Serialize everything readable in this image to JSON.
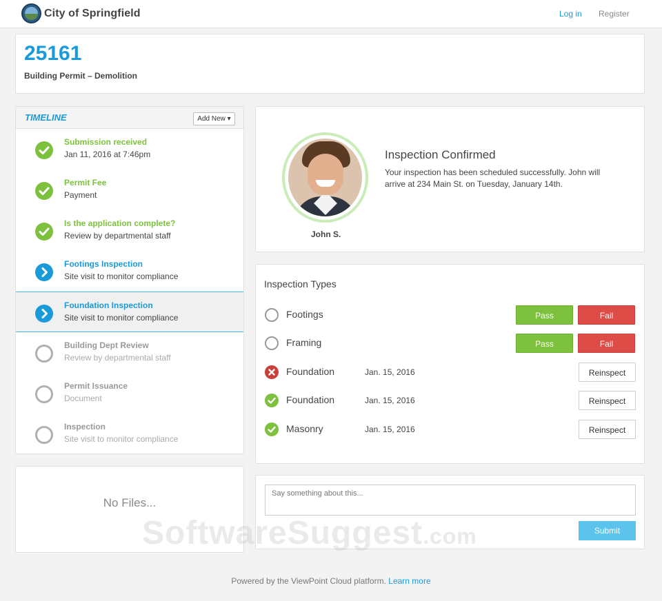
{
  "header": {
    "city_name": "City of Springfield",
    "login_label": "Log in",
    "register_label": "Register",
    "logo_icon": "city-seal-icon"
  },
  "permit": {
    "number": "25161",
    "type": "Building Permit – Demolition"
  },
  "timeline": {
    "title": "TIMELINE",
    "add_new_label": "Add New",
    "items": [
      {
        "label": "Submission received",
        "sub": "Jan 11, 2016 at 7:46pm",
        "status": "done"
      },
      {
        "label": "Permit Fee",
        "sub": "Payment",
        "status": "done"
      },
      {
        "label": "Is the application complete?",
        "sub": "Review by departmental staff",
        "status": "done"
      },
      {
        "label": "Footings Inspection",
        "sub": "Site visit to monitor compliance",
        "status": "next"
      },
      {
        "label": "Foundation Inspection",
        "sub": "Site visit to monitor compliance",
        "status": "next"
      },
      {
        "label": "Building Dept Review",
        "sub": "Review by departmental staff",
        "status": "todo"
      },
      {
        "label": "Permit Issuance",
        "sub": "Document",
        "status": "todo"
      },
      {
        "label": "Inspection",
        "sub": "Site visit to monitor compliance",
        "status": "todo"
      }
    ]
  },
  "files": {
    "empty_text": "No Files..."
  },
  "confirmation": {
    "title": "Inspection Confirmed",
    "message": "Your inspection has been scheduled successfully. John will arrive at 234 Main St. on Tuesday, January 14th.",
    "inspector_name": "John S."
  },
  "inspection_types": {
    "title": "Inspection Types",
    "rows": [
      {
        "name": "Footings",
        "date": "",
        "status": "pending",
        "pass_label": "Pass",
        "fail_label": "Fail"
      },
      {
        "name": "Framing",
        "date": "",
        "status": "pending",
        "pass_label": "Pass",
        "fail_label": "Fail"
      },
      {
        "name": "Foundation",
        "date": "Jan. 15, 2016",
        "status": "failed",
        "reinspect_label": "Reinspect"
      },
      {
        "name": "Foundation",
        "date": "Jan. 15, 2016",
        "status": "passed",
        "reinspect_label": "Reinspect"
      },
      {
        "name": "Masonry",
        "date": "Jan. 15, 2016",
        "status": "passed",
        "reinspect_label": "Reinspect"
      }
    ]
  },
  "comment": {
    "placeholder": "Say something about this...",
    "submit_label": "Submit"
  },
  "watermark": {
    "brand": "SoftwareSuggest",
    "suffix": ".com"
  },
  "footer": {
    "text": "Powered by the ViewPoint Cloud platform.",
    "link_label": "Learn more"
  },
  "colors": {
    "accent_blue": "#1a9ad9",
    "pass_green": "#7dc13e",
    "fail_red": "#de4c47",
    "submit_blue": "#5bc3ec"
  }
}
